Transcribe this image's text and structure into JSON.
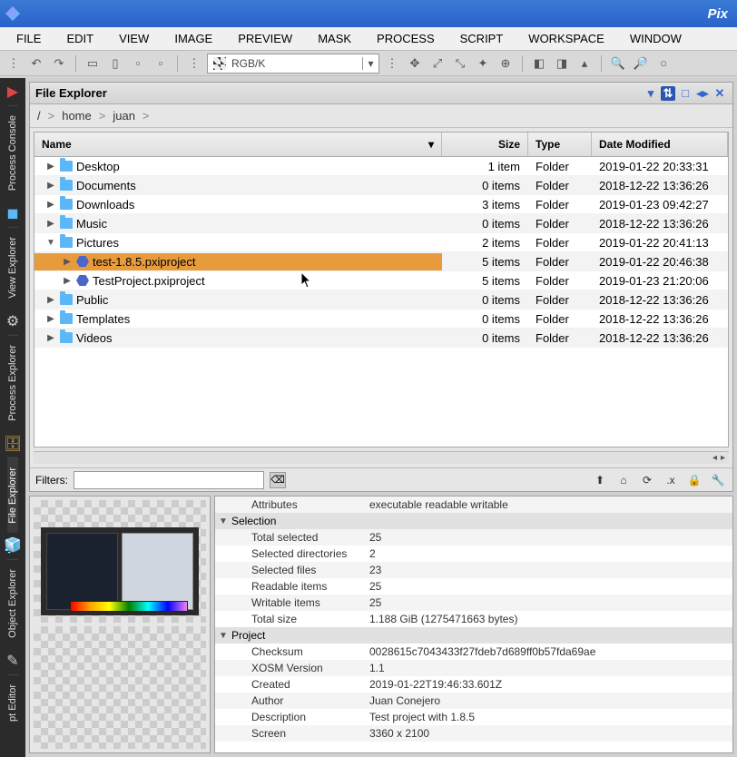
{
  "app": {
    "title": "Pix"
  },
  "menu": [
    "FILE",
    "EDIT",
    "VIEW",
    "IMAGE",
    "PREVIEW",
    "MASK",
    "PROCESS",
    "SCRIPT",
    "WORKSPACE",
    "WINDOW"
  ],
  "toolbar": {
    "color_label": "RGB/K"
  },
  "rail": [
    "Process Console",
    "View Explorer",
    "Process Explorer",
    "File Explorer",
    "Object Explorer",
    "pt Editor"
  ],
  "explorer": {
    "title": "File Explorer",
    "breadcrumb": [
      "/",
      "home",
      "juan"
    ],
    "columns": {
      "name": "Name",
      "size": "Size",
      "type": "Type",
      "date": "Date Modified"
    },
    "rows": [
      {
        "indent": 0,
        "arrow": "▶",
        "icon": "folder",
        "name": "Desktop",
        "size": "1 item",
        "type": "Folder",
        "date": "2019-01-22 20:33:31",
        "sel": false
      },
      {
        "indent": 0,
        "arrow": "▶",
        "icon": "folder",
        "name": "Documents",
        "size": "0 items",
        "type": "Folder",
        "date": "2018-12-22 13:36:26",
        "sel": false
      },
      {
        "indent": 0,
        "arrow": "▶",
        "icon": "folder",
        "name": "Downloads",
        "size": "3 items",
        "type": "Folder",
        "date": "2019-01-23 09:42:27",
        "sel": false
      },
      {
        "indent": 0,
        "arrow": "▶",
        "icon": "folder",
        "name": "Music",
        "size": "0 items",
        "type": "Folder",
        "date": "2018-12-22 13:36:26",
        "sel": false
      },
      {
        "indent": 0,
        "arrow": "▼",
        "icon": "folder",
        "name": "Pictures",
        "size": "2 items",
        "type": "Folder",
        "date": "2019-01-22 20:41:13",
        "sel": false
      },
      {
        "indent": 1,
        "arrow": "▶",
        "icon": "proj",
        "name": "test-1.8.5.pxiproject",
        "size": "5 items",
        "type": "Folder",
        "date": "2019-01-22 20:46:38",
        "sel": true
      },
      {
        "indent": 1,
        "arrow": "▶",
        "icon": "proj",
        "name": "TestProject.pxiproject",
        "size": "5 items",
        "type": "Folder",
        "date": "2019-01-23 21:20:06",
        "sel": false
      },
      {
        "indent": 0,
        "arrow": "▶",
        "icon": "folder",
        "name": "Public",
        "size": "0 items",
        "type": "Folder",
        "date": "2018-12-22 13:36:26",
        "sel": false
      },
      {
        "indent": 0,
        "arrow": "▶",
        "icon": "folder",
        "name": "Templates",
        "size": "0 items",
        "type": "Folder",
        "date": "2018-12-22 13:36:26",
        "sel": false
      },
      {
        "indent": 0,
        "arrow": "▶",
        "icon": "folder",
        "name": "Videos",
        "size": "0 items",
        "type": "Folder",
        "date": "2018-12-22 13:36:26",
        "sel": false
      }
    ],
    "filters_label": "Filters:"
  },
  "props": {
    "attributes_label": "Attributes",
    "attributes_value": "executable readable writable",
    "selection_label": "Selection",
    "selection": [
      {
        "label": "Total selected",
        "value": "25"
      },
      {
        "label": "Selected directories",
        "value": "2"
      },
      {
        "label": "Selected files",
        "value": "23"
      },
      {
        "label": "Readable items",
        "value": "25"
      },
      {
        "label": "Writable items",
        "value": "25"
      },
      {
        "label": "Total size",
        "value": "1.188 GiB (1275471663 bytes)"
      }
    ],
    "project_label": "Project",
    "project": [
      {
        "label": "Checksum",
        "value": "0028615c7043433f27fdeb7d689ff0b57fda69ae"
      },
      {
        "label": "XOSM Version",
        "value": "1.1"
      },
      {
        "label": "Created",
        "value": "2019-01-22T19:46:33.601Z"
      },
      {
        "label": "Author",
        "value": "Juan Conejero"
      },
      {
        "label": "Description",
        "value": "Test project with 1.8.5"
      },
      {
        "label": "Screen",
        "value": "3360 x 2100"
      }
    ]
  }
}
